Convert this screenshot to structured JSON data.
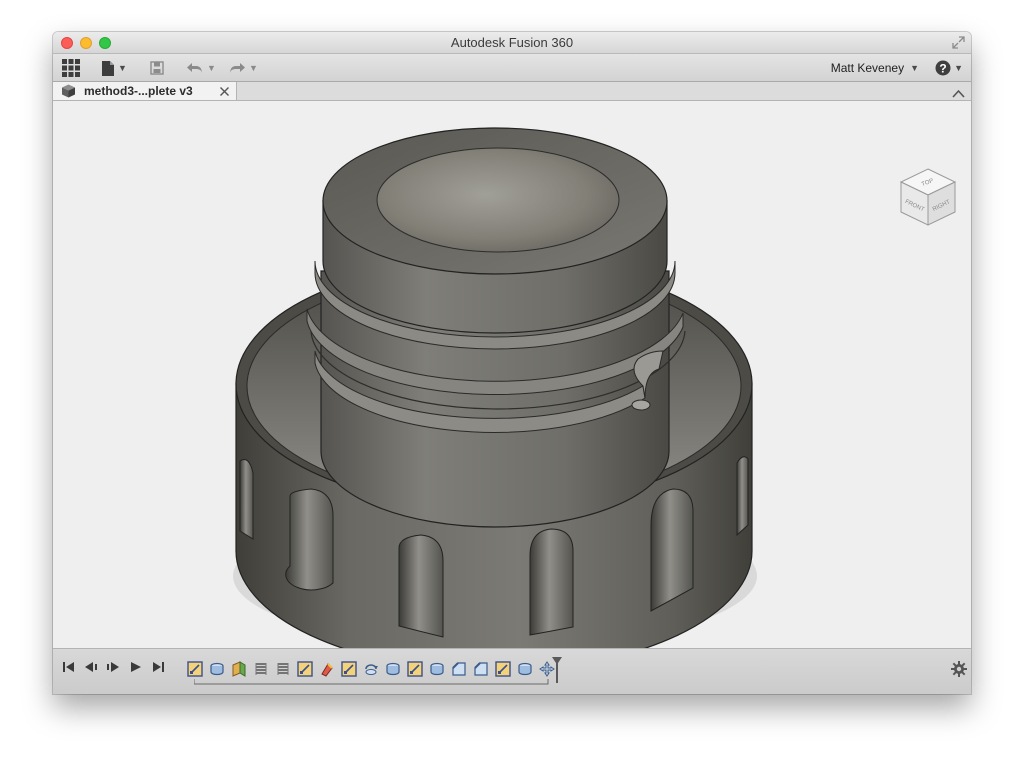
{
  "window": {
    "title": "Autodesk Fusion 360"
  },
  "toolbar": {
    "items": [
      "data-panel-grid-icon",
      "file-menu-icon",
      "save-icon",
      "undo-icon",
      "redo-icon"
    ],
    "user_name": "Matt Keveney",
    "help_icon": "help-icon"
  },
  "tabs": [
    {
      "label": "method3-...plete v3",
      "active": true
    }
  ],
  "viewcube": {
    "faces": [
      "TOP",
      "FRONT",
      "RIGHT"
    ]
  },
  "timeline": {
    "playback_controls": [
      "go-to-start",
      "step-back",
      "play",
      "step-forward",
      "go-to-end"
    ],
    "features": [
      "sketch",
      "extrude",
      "construction-plane",
      "thread",
      "thread",
      "sketch",
      "appearance",
      "sketch",
      "revolve",
      "extrude",
      "sketch",
      "extrude",
      "chamfer",
      "chamfer",
      "sketch",
      "extrude",
      "move"
    ]
  },
  "colors": {
    "viewport_background": "#efefef",
    "model_base": "#5c5b55",
    "accent_marker": "#5a5a5a"
  }
}
